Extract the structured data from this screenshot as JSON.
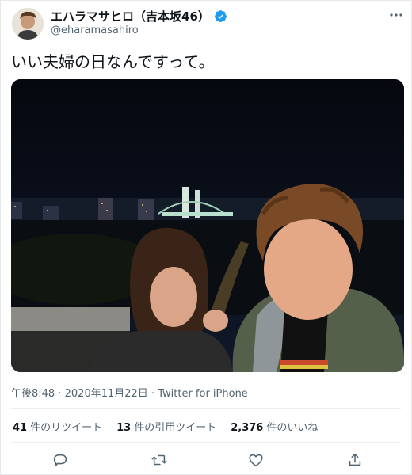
{
  "tweet": {
    "author_name": "エハラマサヒロ（吉本坂46）",
    "author_handle": "@eharamasahiro",
    "verified": true,
    "text": "いい夫婦の日なんですって。",
    "time": "午後8:48",
    "date": "2020年11月22日",
    "source": "Twitter for iPhone",
    "separator": "·"
  },
  "stats": [
    {
      "count": "41",
      "label": "件のリツイート"
    },
    {
      "count": "13",
      "label": "件の引用ツイート"
    },
    {
      "count": "2,376",
      "label": "件のいいね"
    }
  ],
  "actions": [
    "reply-icon",
    "retweet-icon",
    "like-icon",
    "share-icon"
  ],
  "colors": {
    "verified": "#1d9bf0",
    "text": "#0f1419",
    "secondary": "#536471"
  }
}
